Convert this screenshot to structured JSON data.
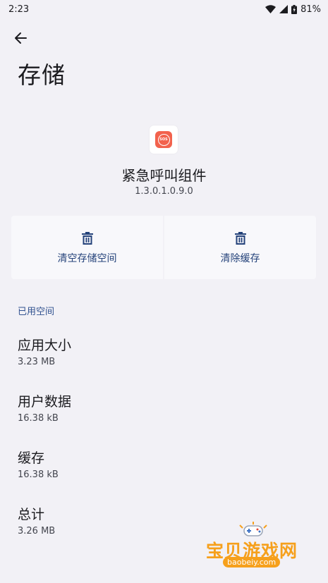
{
  "status_bar": {
    "time": "2:23",
    "battery": "81%"
  },
  "page": {
    "title": "存储"
  },
  "app": {
    "icon_text": "SOS",
    "name": "紧急呼叫组件",
    "version": "1.3.0.1.0.9.0"
  },
  "actions": [
    {
      "label": "清空存储空间",
      "icon": "trash-icon"
    },
    {
      "label": "清除缓存",
      "icon": "trash-icon"
    }
  ],
  "storage": {
    "section_title": "已用空间",
    "items": [
      {
        "title": "应用大小",
        "value": "3.23 MB"
      },
      {
        "title": "用户数据",
        "value": "16.38 kB"
      },
      {
        "title": "缓存",
        "value": "16.38 kB"
      },
      {
        "title": "总计",
        "value": "3.26 MB"
      }
    ]
  },
  "watermark": {
    "text": "宝贝游戏网",
    "url": "baobeiy.com"
  },
  "colors": {
    "background": "#f2f1f6",
    "accent": "#30518f",
    "app_icon": "#f2624d",
    "watermark": "#f6a01c"
  }
}
